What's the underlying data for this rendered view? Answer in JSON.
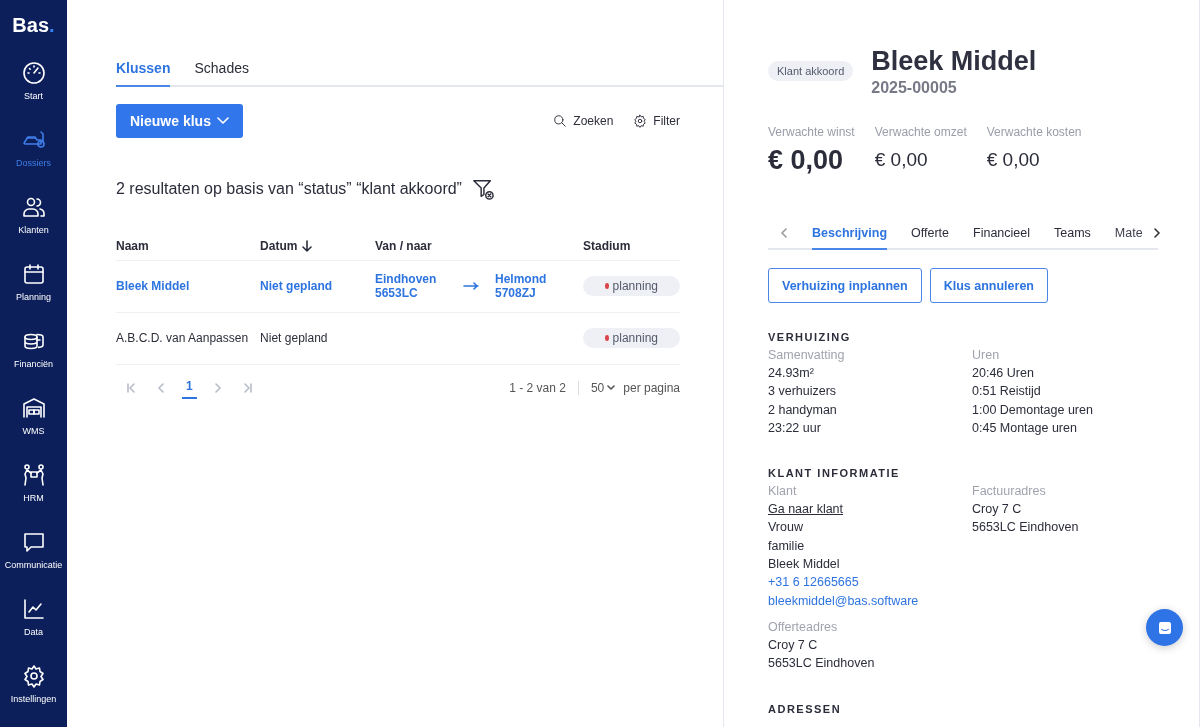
{
  "sidebar": {
    "logo": {
      "name": "Bas",
      "mark": "."
    },
    "items": [
      {
        "label": "Start",
        "kind": "gauge",
        "selected": false
      },
      {
        "label": "Dossiers",
        "kind": "truck",
        "selected": true
      },
      {
        "label": "Klanten",
        "kind": "people",
        "selected": false
      },
      {
        "label": "Planning",
        "kind": "calendar",
        "selected": false
      },
      {
        "label": "Financiën",
        "kind": "coins",
        "selected": false
      },
      {
        "label": "WMS",
        "kind": "warehouse",
        "selected": false
      },
      {
        "label": "HRM",
        "kind": "movers",
        "selected": false
      },
      {
        "label": "Communicatie",
        "kind": "chat",
        "selected": false
      },
      {
        "label": "Data",
        "kind": "chart",
        "selected": false
      },
      {
        "label": "Instellingen",
        "kind": "gear",
        "selected": false
      }
    ]
  },
  "list": {
    "tabs": [
      {
        "label": "Klussen",
        "selected": true
      },
      {
        "label": "Schades",
        "selected": false
      }
    ],
    "new_button": "Nieuwe klus",
    "actions": [
      {
        "label": "Zoeken",
        "kind": "search"
      },
      {
        "label": "Filter",
        "kind": "gear"
      }
    ],
    "results": "2 resultaten op basis van “status” “klant akkoord”",
    "table": {
      "columns": [
        {
          "label": "Naam",
          "sorted": false
        },
        {
          "label": "Datum",
          "sorted": true
        },
        {
          "label": "Van / naar",
          "sorted": false
        },
        {
          "label": "Stadium",
          "sorted": false
        }
      ],
      "rows": [
        {
          "selected": true,
          "name": "Bleek Middel",
          "date": "Niet gepland",
          "from": [
            "Eindhoven",
            "5653LC"
          ],
          "to": [
            "Helmond",
            "5708ZJ"
          ],
          "stage": "planning",
          "color": "#d9474b"
        },
        {
          "selected": false,
          "name": "A.B.C.D. van Aanpassen",
          "date": "Niet gepland",
          "stage": "planning",
          "color": "#d9474b"
        }
      ]
    },
    "pagination": {
      "pages": [
        {
          "label": "1",
          "selected": true
        }
      ],
      "range": "1 - 2 van 2",
      "per_page": "50",
      "per_page_label": "per pagina"
    }
  },
  "detail": {
    "badge": "Klant akkoord",
    "title": "Bleek Middel",
    "number": "2025-00005",
    "stats": [
      {
        "label": "Verwachte winst",
        "value": "€ 0,00",
        "primary": true
      },
      {
        "label": "Verwachte omzet",
        "value": "€ 0,00",
        "primary": false
      },
      {
        "label": "Verwachte kosten",
        "value": "€ 0,00",
        "primary": false
      }
    ],
    "tabs": [
      {
        "label": "Beschrijving",
        "selected": true
      },
      {
        "label": "Offerte",
        "selected": false
      },
      {
        "label": "Financieel",
        "selected": false
      },
      {
        "label": "Teams",
        "selected": false
      },
      {
        "label": "Mate",
        "selected": false
      }
    ],
    "buttons": [
      "Verhuizing inplannen",
      "Klus annuleren"
    ],
    "sections": [
      {
        "heading": "VERHUIZING",
        "columns": [
          {
            "groups": [
              {
                "label": "Samenvatting",
                "lines": [
                  {
                    "text": "24.93m²",
                    "kind": "text"
                  },
                  {
                    "text": "3 verhuizers",
                    "kind": "text"
                  },
                  {
                    "text": "2 handyman",
                    "kind": "text"
                  },
                  {
                    "text": "23:22 uur",
                    "kind": "text"
                  }
                ]
              }
            ]
          },
          {
            "groups": [
              {
                "label": "Uren",
                "lines": [
                  {
                    "text": "20:46 Uren",
                    "kind": "text"
                  },
                  {
                    "text": "0:51 Reistijd",
                    "kind": "text"
                  },
                  {
                    "text": "1:00 Demontage uren",
                    "kind": "text"
                  },
                  {
                    "text": "0:45 Montage uren",
                    "kind": "text"
                  }
                ]
              }
            ]
          }
        ]
      },
      {
        "heading": "KLANT INFORMATIE",
        "columns": [
          {
            "groups": [
              {
                "label": "Klant",
                "lines": [
                  {
                    "text": "Ga naar klant",
                    "kind": "underline"
                  },
                  {
                    "text": "Vrouw",
                    "kind": "text"
                  },
                  {
                    "text": "familie",
                    "kind": "text"
                  },
                  {
                    "text": "Bleek Middel",
                    "kind": "text"
                  },
                  {
                    "text": "+31 6 12665665",
                    "kind": "link"
                  },
                  {
                    "text": "bleekmiddel@bas.software",
                    "kind": "link"
                  }
                ]
              },
              {
                "label": "Offerteadres",
                "lines": [
                  {
                    "text": "Croy 7 C",
                    "kind": "text"
                  },
                  {
                    "text": "5653LC Eindhoven",
                    "kind": "text"
                  }
                ]
              }
            ]
          },
          {
            "groups": [
              {
                "label": "Factuuradres",
                "lines": [
                  {
                    "text": "Croy 7 C",
                    "kind": "text"
                  },
                  {
                    "text": "5653LC Eindhoven",
                    "kind": "text"
                  }
                ]
              }
            ]
          }
        ]
      },
      {
        "heading": "ADRESSEN"
      }
    ]
  }
}
